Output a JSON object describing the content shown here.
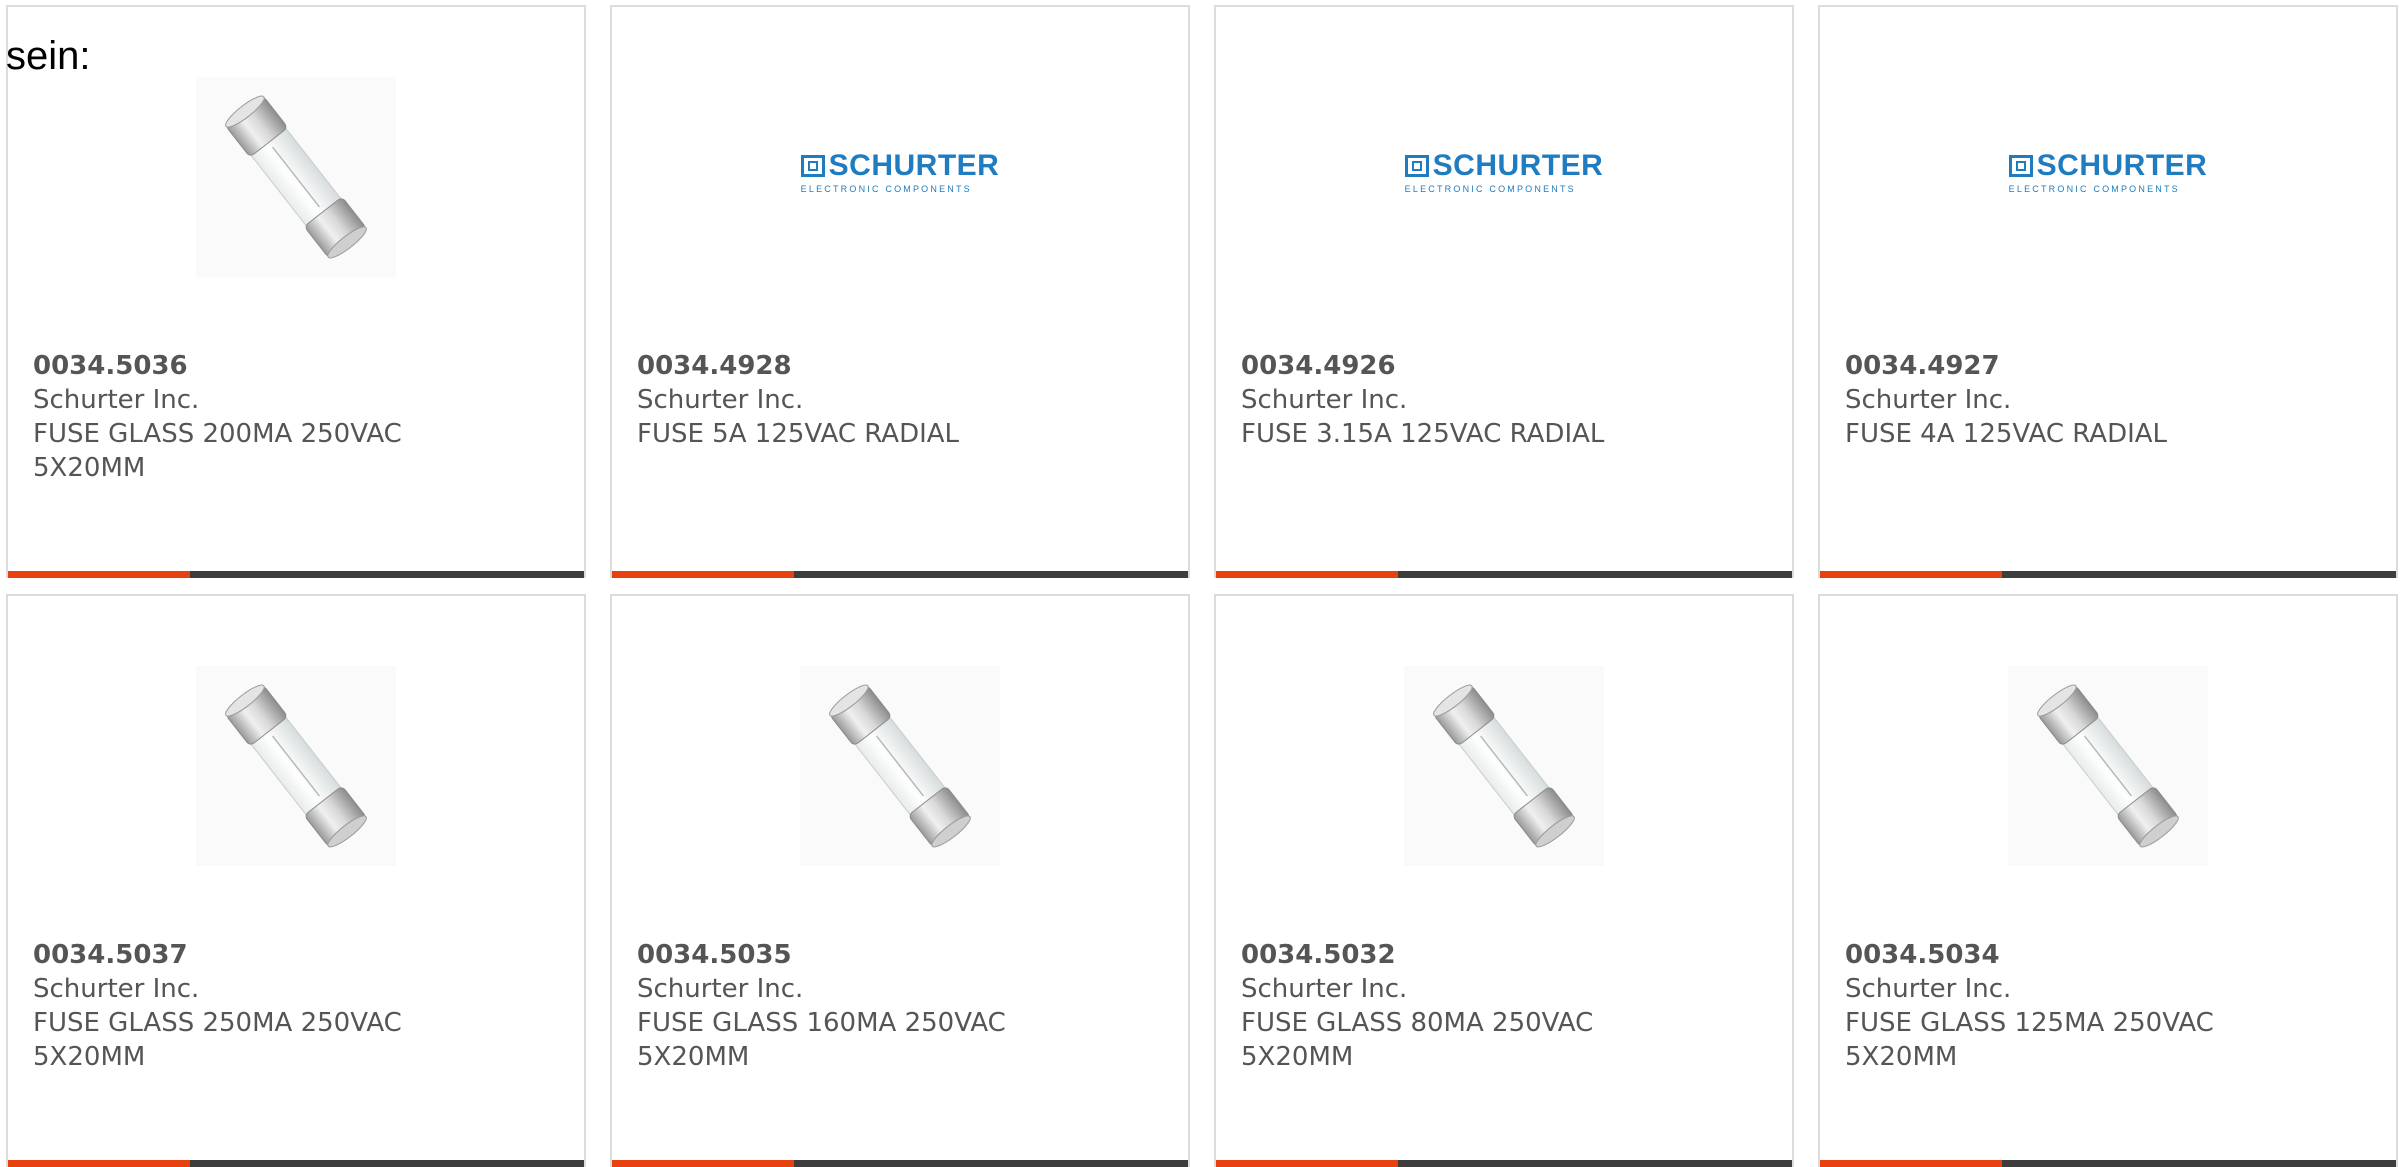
{
  "intro_text": "sein:",
  "colors": {
    "accent": "#e8400f",
    "bar": "#3d3d3d",
    "text": "#555555",
    "logo_blue": "#1f7cc1"
  },
  "logo": {
    "word": "SCHURTER",
    "sub": "ELECTRONIC COMPONENTS"
  },
  "products": [
    {
      "part_number": "0034.5036",
      "manufacturer": "Schurter Inc.",
      "desc_line1": "FUSE GLASS 200MA 250VAC",
      "desc_line2": "5X20MM",
      "image": "glass-fuse-image"
    },
    {
      "part_number": "0034.4928",
      "manufacturer": "Schurter Inc.",
      "desc_line1": "FUSE 5A 125VAC RADIAL",
      "desc_line2": "",
      "image": "schurter-logo"
    },
    {
      "part_number": "0034.4926",
      "manufacturer": "Schurter Inc.",
      "desc_line1": "FUSE 3.15A 125VAC RADIAL",
      "desc_line2": "",
      "image": "schurter-logo"
    },
    {
      "part_number": "0034.4927",
      "manufacturer": "Schurter Inc.",
      "desc_line1": "FUSE 4A 125VAC RADIAL",
      "desc_line2": "",
      "image": "schurter-logo"
    },
    {
      "part_number": "0034.5037",
      "manufacturer": "Schurter Inc.",
      "desc_line1": "FUSE GLASS 250MA 250VAC",
      "desc_line2": "5X20MM",
      "image": "glass-fuse-image"
    },
    {
      "part_number": "0034.5035",
      "manufacturer": "Schurter Inc.",
      "desc_line1": "FUSE GLASS 160MA 250VAC",
      "desc_line2": "5X20MM",
      "image": "glass-fuse-image"
    },
    {
      "part_number": "0034.5032",
      "manufacturer": "Schurter Inc.",
      "desc_line1": "FUSE GLASS 80MA 250VAC",
      "desc_line2": "5X20MM",
      "image": "glass-fuse-image"
    },
    {
      "part_number": "0034.5034",
      "manufacturer": "Schurter Inc.",
      "desc_line1": "FUSE GLASS 125MA 250VAC",
      "desc_line2": "5X20MM",
      "image": "glass-fuse-image"
    }
  ]
}
